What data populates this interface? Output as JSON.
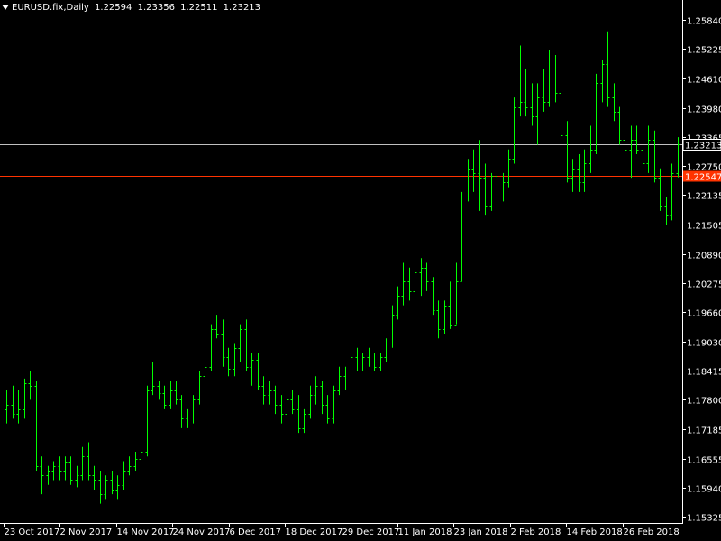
{
  "header": {
    "symbol_timeframe": "EURUSD.fix,Daily",
    "open": "1.22594",
    "high": "1.23356",
    "low": "1.22511",
    "close": "1.23213"
  },
  "colors": {
    "background": "#000000",
    "bars": "#00ff00",
    "axis": "#ffffff",
    "bid_line": "#ff3300",
    "crosshair_line": "#c0c0c0"
  },
  "chart_data": {
    "type": "ohlc",
    "title": "",
    "xlabel": "",
    "ylabel": "",
    "ylim": [
      1.1525,
      1.2613
    ],
    "y_ticks": [
      "1.25840",
      "1.25225",
      "1.24610",
      "1.23980",
      "1.23365",
      "1.22750",
      "1.22135",
      "1.21505",
      "1.20890",
      "1.20275",
      "1.19660",
      "1.19030",
      "1.18415",
      "1.17800",
      "1.17185",
      "1.16555",
      "1.15940",
      "1.15325"
    ],
    "x_ticks": [
      "23 Oct 2017",
      "2 Nov 2017",
      "14 Nov 2017",
      "24 Nov 2017",
      "6 Dec 2017",
      "18 Dec 2017",
      "29 Dec 2017",
      "11 Jan 2018",
      "23 Jan 2018",
      "2 Feb 2018",
      "14 Feb 2018",
      "26 Feb 2018"
    ],
    "horizontal_lines": [
      {
        "label": "1.23213",
        "value": 1.23213,
        "color": "#c0c0c0"
      },
      {
        "label": "1.22547",
        "value": 1.22547,
        "color": "#ff3300"
      }
    ],
    "bars": [
      {
        "o": 1.176,
        "h": 1.18,
        "l": 1.173,
        "c": 1.177
      },
      {
        "o": 1.177,
        "h": 1.181,
        "l": 1.174,
        "c": 1.175
      },
      {
        "o": 1.175,
        "h": 1.18,
        "l": 1.173,
        "c": 1.176
      },
      {
        "o": 1.176,
        "h": 1.1825,
        "l": 1.174,
        "c": 1.1815
      },
      {
        "o": 1.1815,
        "h": 1.184,
        "l": 1.178,
        "c": 1.181
      },
      {
        "o": 1.181,
        "h": 1.182,
        "l": 1.163,
        "c": 1.164
      },
      {
        "o": 1.164,
        "h": 1.166,
        "l": 1.158,
        "c": 1.162
      },
      {
        "o": 1.162,
        "h": 1.164,
        "l": 1.16,
        "c": 1.163
      },
      {
        "o": 1.163,
        "h": 1.165,
        "l": 1.161,
        "c": 1.164
      },
      {
        "o": 1.164,
        "h": 1.166,
        "l": 1.161,
        "c": 1.163
      },
      {
        "o": 1.163,
        "h": 1.166,
        "l": 1.161,
        "c": 1.165
      },
      {
        "o": 1.165,
        "h": 1.166,
        "l": 1.16,
        "c": 1.161
      },
      {
        "o": 1.161,
        "h": 1.164,
        "l": 1.1595,
        "c": 1.162
      },
      {
        "o": 1.162,
        "h": 1.168,
        "l": 1.161,
        "c": 1.166
      },
      {
        "o": 1.166,
        "h": 1.169,
        "l": 1.161,
        "c": 1.162
      },
      {
        "o": 1.162,
        "h": 1.164,
        "l": 1.159,
        "c": 1.161
      },
      {
        "o": 1.161,
        "h": 1.163,
        "l": 1.156,
        "c": 1.158
      },
      {
        "o": 1.158,
        "h": 1.162,
        "l": 1.157,
        "c": 1.161
      },
      {
        "o": 1.161,
        "h": 1.163,
        "l": 1.158,
        "c": 1.159
      },
      {
        "o": 1.159,
        "h": 1.162,
        "l": 1.157,
        "c": 1.16
      },
      {
        "o": 1.16,
        "h": 1.165,
        "l": 1.159,
        "c": 1.163
      },
      {
        "o": 1.163,
        "h": 1.166,
        "l": 1.162,
        "c": 1.164
      },
      {
        "o": 1.164,
        "h": 1.167,
        "l": 1.163,
        "c": 1.1655
      },
      {
        "o": 1.1655,
        "h": 1.169,
        "l": 1.164,
        "c": 1.167
      },
      {
        "o": 1.167,
        "h": 1.181,
        "l": 1.166,
        "c": 1.18
      },
      {
        "o": 1.18,
        "h": 1.186,
        "l": 1.179,
        "c": 1.181
      },
      {
        "o": 1.181,
        "h": 1.182,
        "l": 1.178,
        "c": 1.1795
      },
      {
        "o": 1.1795,
        "h": 1.181,
        "l": 1.176,
        "c": 1.177
      },
      {
        "o": 1.177,
        "h": 1.182,
        "l": 1.176,
        "c": 1.18
      },
      {
        "o": 1.18,
        "h": 1.182,
        "l": 1.177,
        "c": 1.178
      },
      {
        "o": 1.178,
        "h": 1.179,
        "l": 1.172,
        "c": 1.174
      },
      {
        "o": 1.174,
        "h": 1.176,
        "l": 1.172,
        "c": 1.1745
      },
      {
        "o": 1.1745,
        "h": 1.179,
        "l": 1.173,
        "c": 1.178
      },
      {
        "o": 1.178,
        "h": 1.184,
        "l": 1.177,
        "c": 1.183
      },
      {
        "o": 1.183,
        "h": 1.186,
        "l": 1.181,
        "c": 1.185
      },
      {
        "o": 1.185,
        "h": 1.194,
        "l": 1.184,
        "c": 1.193
      },
      {
        "o": 1.193,
        "h": 1.196,
        "l": 1.191,
        "c": 1.192
      },
      {
        "o": 1.192,
        "h": 1.195,
        "l": 1.185,
        "c": 1.187
      },
      {
        "o": 1.187,
        "h": 1.189,
        "l": 1.183,
        "c": 1.1845
      },
      {
        "o": 1.1845,
        "h": 1.19,
        "l": 1.183,
        "c": 1.189
      },
      {
        "o": 1.189,
        "h": 1.194,
        "l": 1.186,
        "c": 1.193
      },
      {
        "o": 1.193,
        "h": 1.195,
        "l": 1.184,
        "c": 1.185
      },
      {
        "o": 1.185,
        "h": 1.188,
        "l": 1.181,
        "c": 1.1865
      },
      {
        "o": 1.1865,
        "h": 1.188,
        "l": 1.18,
        "c": 1.181
      },
      {
        "o": 1.181,
        "h": 1.183,
        "l": 1.177,
        "c": 1.179
      },
      {
        "o": 1.179,
        "h": 1.182,
        "l": 1.177,
        "c": 1.18
      },
      {
        "o": 1.18,
        "h": 1.181,
        "l": 1.175,
        "c": 1.177
      },
      {
        "o": 1.177,
        "h": 1.179,
        "l": 1.173,
        "c": 1.175
      },
      {
        "o": 1.175,
        "h": 1.179,
        "l": 1.174,
        "c": 1.178
      },
      {
        "o": 1.178,
        "h": 1.18,
        "l": 1.175,
        "c": 1.176
      },
      {
        "o": 1.176,
        "h": 1.179,
        "l": 1.171,
        "c": 1.172
      },
      {
        "o": 1.172,
        "h": 1.176,
        "l": 1.171,
        "c": 1.175
      },
      {
        "o": 1.175,
        "h": 1.181,
        "l": 1.174,
        "c": 1.179
      },
      {
        "o": 1.179,
        "h": 1.183,
        "l": 1.177,
        "c": 1.181
      },
      {
        "o": 1.181,
        "h": 1.182,
        "l": 1.175,
        "c": 1.177
      },
      {
        "o": 1.177,
        "h": 1.179,
        "l": 1.173,
        "c": 1.174
      },
      {
        "o": 1.174,
        "h": 1.181,
        "l": 1.173,
        "c": 1.18
      },
      {
        "o": 1.18,
        "h": 1.185,
        "l": 1.179,
        "c": 1.183
      },
      {
        "o": 1.183,
        "h": 1.185,
        "l": 1.18,
        "c": 1.182
      },
      {
        "o": 1.182,
        "h": 1.19,
        "l": 1.181,
        "c": 1.187
      },
      {
        "o": 1.187,
        "h": 1.189,
        "l": 1.184,
        "c": 1.186
      },
      {
        "o": 1.186,
        "h": 1.188,
        "l": 1.184,
        "c": 1.187
      },
      {
        "o": 1.187,
        "h": 1.189,
        "l": 1.185,
        "c": 1.186
      },
      {
        "o": 1.186,
        "h": 1.188,
        "l": 1.184,
        "c": 1.185
      },
      {
        "o": 1.185,
        "h": 1.188,
        "l": 1.184,
        "c": 1.187
      },
      {
        "o": 1.187,
        "h": 1.191,
        "l": 1.186,
        "c": 1.19
      },
      {
        "o": 1.19,
        "h": 1.198,
        "l": 1.189,
        "c": 1.196
      },
      {
        "o": 1.196,
        "h": 1.202,
        "l": 1.195,
        "c": 1.2
      },
      {
        "o": 1.2,
        "h": 1.207,
        "l": 1.198,
        "c": 1.203
      },
      {
        "o": 1.203,
        "h": 1.206,
        "l": 1.199,
        "c": 1.201
      },
      {
        "o": 1.201,
        "h": 1.208,
        "l": 1.2,
        "c": 1.205
      },
      {
        "o": 1.205,
        "h": 1.208,
        "l": 1.2,
        "c": 1.206
      },
      {
        "o": 1.206,
        "h": 1.207,
        "l": 1.201,
        "c": 1.203
      },
      {
        "o": 1.203,
        "h": 1.204,
        "l": 1.196,
        "c": 1.197
      },
      {
        "o": 1.197,
        "h": 1.199,
        "l": 1.191,
        "c": 1.193
      },
      {
        "o": 1.193,
        "h": 1.199,
        "l": 1.192,
        "c": 1.198
      },
      {
        "o": 1.198,
        "h": 1.203,
        "l": 1.193,
        "c": 1.194
      },
      {
        "o": 1.194,
        "h": 1.207,
        "l": 1.194,
        "c": 1.203
      },
      {
        "o": 1.203,
        "h": 1.222,
        "l": 1.203,
        "c": 1.221
      },
      {
        "o": 1.221,
        "h": 1.229,
        "l": 1.22,
        "c": 1.227
      },
      {
        "o": 1.227,
        "h": 1.231,
        "l": 1.222,
        "c": 1.226
      },
      {
        "o": 1.226,
        "h": 1.233,
        "l": 1.218,
        "c": 1.225
      },
      {
        "o": 1.225,
        "h": 1.228,
        "l": 1.217,
        "c": 1.219
      },
      {
        "o": 1.219,
        "h": 1.226,
        "l": 1.218,
        "c": 1.2255
      },
      {
        "o": 1.2255,
        "h": 1.229,
        "l": 1.22,
        "c": 1.223
      },
      {
        "o": 1.223,
        "h": 1.226,
        "l": 1.22,
        "c": 1.224
      },
      {
        "o": 1.224,
        "h": 1.231,
        "l": 1.223,
        "c": 1.229
      },
      {
        "o": 1.229,
        "h": 1.242,
        "l": 1.228,
        "c": 1.24
      },
      {
        "o": 1.24,
        "h": 1.253,
        "l": 1.238,
        "c": 1.241
      },
      {
        "o": 1.241,
        "h": 1.248,
        "l": 1.238,
        "c": 1.24
      },
      {
        "o": 1.24,
        "h": 1.245,
        "l": 1.236,
        "c": 1.238
      },
      {
        "o": 1.238,
        "h": 1.245,
        "l": 1.232,
        "c": 1.242
      },
      {
        "o": 1.242,
        "h": 1.248,
        "l": 1.239,
        "c": 1.241
      },
      {
        "o": 1.241,
        "h": 1.252,
        "l": 1.24,
        "c": 1.25
      },
      {
        "o": 1.25,
        "h": 1.251,
        "l": 1.241,
        "c": 1.243
      },
      {
        "o": 1.243,
        "h": 1.244,
        "l": 1.232,
        "c": 1.234
      },
      {
        "o": 1.234,
        "h": 1.237,
        "l": 1.224,
        "c": 1.225
      },
      {
        "o": 1.225,
        "h": 1.229,
        "l": 1.222,
        "c": 1.227
      },
      {
        "o": 1.227,
        "h": 1.23,
        "l": 1.222,
        "c": 1.224
      },
      {
        "o": 1.224,
        "h": 1.231,
        "l": 1.222,
        "c": 1.228
      },
      {
        "o": 1.228,
        "h": 1.236,
        "l": 1.226,
        "c": 1.231
      },
      {
        "o": 1.231,
        "h": 1.247,
        "l": 1.23,
        "c": 1.245
      },
      {
        "o": 1.245,
        "h": 1.25,
        "l": 1.241,
        "c": 1.249
      },
      {
        "o": 1.249,
        "h": 1.256,
        "l": 1.24,
        "c": 1.242
      },
      {
        "o": 1.242,
        "h": 1.245,
        "l": 1.237,
        "c": 1.239
      },
      {
        "o": 1.239,
        "h": 1.24,
        "l": 1.232,
        "c": 1.233
      },
      {
        "o": 1.233,
        "h": 1.235,
        "l": 1.228,
        "c": 1.231
      },
      {
        "o": 1.231,
        "h": 1.236,
        "l": 1.225,
        "c": 1.233
      },
      {
        "o": 1.233,
        "h": 1.236,
        "l": 1.23,
        "c": 1.231
      },
      {
        "o": 1.231,
        "h": 1.234,
        "l": 1.224,
        "c": 1.228
      },
      {
        "o": 1.228,
        "h": 1.236,
        "l": 1.226,
        "c": 1.233
      },
      {
        "o": 1.233,
        "h": 1.235,
        "l": 1.224,
        "c": 1.225
      },
      {
        "o": 1.225,
        "h": 1.227,
        "l": 1.218,
        "c": 1.219
      },
      {
        "o": 1.219,
        "h": 1.221,
        "l": 1.215,
        "c": 1.217
      },
      {
        "o": 1.217,
        "h": 1.228,
        "l": 1.216,
        "c": 1.226
      },
      {
        "o": 1.226,
        "h": 1.2336,
        "l": 1.2251,
        "c": 1.2321
      }
    ]
  }
}
